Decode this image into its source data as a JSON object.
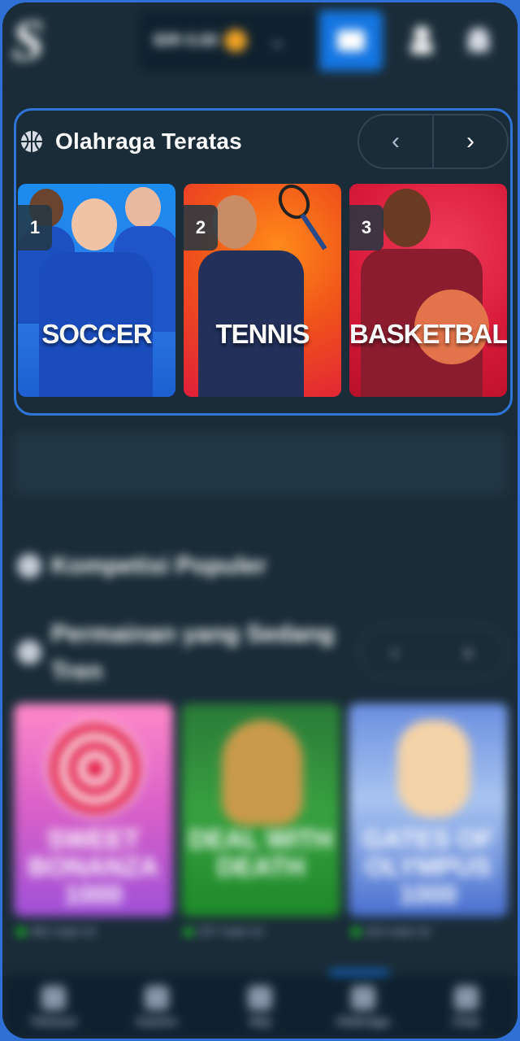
{
  "header": {
    "logo": "S",
    "balance": "IDR 0.00",
    "icons": [
      "wallet-icon",
      "user-icon",
      "notification-icon"
    ]
  },
  "top_sports": {
    "title": "Olahraga Teratas",
    "prev_label": "‹",
    "next_label": "›",
    "cards": [
      {
        "rank": "1",
        "label": "SOCCER",
        "color": "#1a8cf0"
      },
      {
        "rank": "2",
        "label": "TENNIS",
        "color": "#f0541a"
      },
      {
        "rank": "3",
        "label": "BASKETBALL",
        "color": "#d81a3a"
      }
    ]
  },
  "popular_competitions": {
    "title": "Kompetisi Populer"
  },
  "trending_games": {
    "title_line1": "Permainan yang Sedang",
    "title_line2": "Tren",
    "prev_label": "‹",
    "next_label": "›",
    "cards": [
      {
        "title": "SWEET BONANZA 1000",
        "players": "481 main ini"
      },
      {
        "title": "DEAL WITH DEATH",
        "players": "237 main ini"
      },
      {
        "title": "GATES OF OLYMPUS 1000",
        "players": "424 main ini"
      }
    ]
  },
  "bottom_nav": {
    "items": [
      "Telusuri",
      "Kasino",
      "Slip",
      "Olahraga",
      "Chat"
    ]
  },
  "colors": {
    "background": "#1a2c38",
    "accent": "#1475e1",
    "focus_outline": "#2f75d8"
  }
}
